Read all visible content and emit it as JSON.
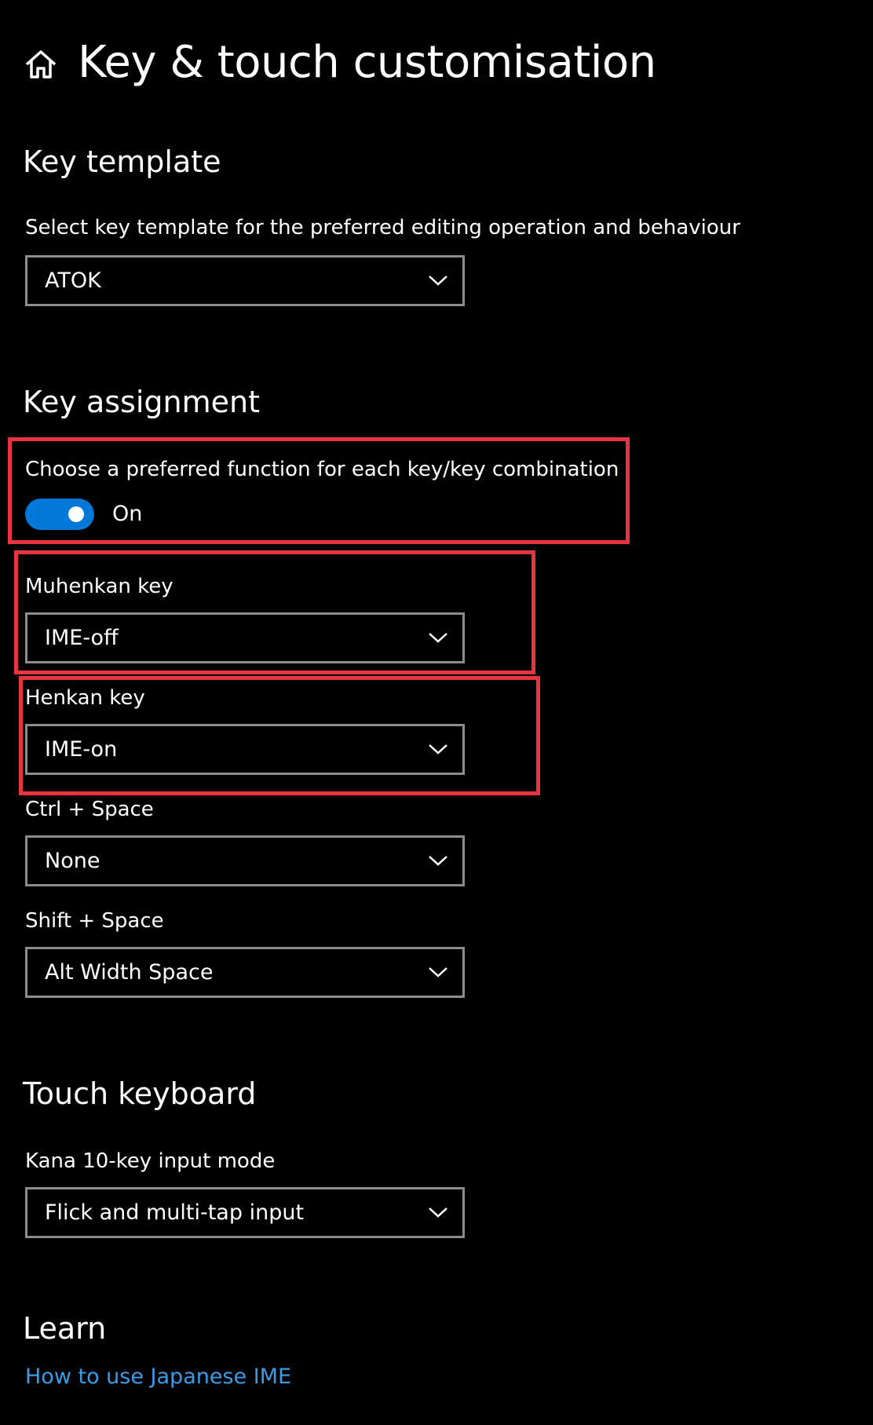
{
  "page": {
    "title": "Key & touch customisation",
    "home_icon": "home-icon"
  },
  "key_template": {
    "heading": "Key template",
    "description": "Select key template for the preferred editing operation and behaviour",
    "value": "ATOK"
  },
  "key_assignment": {
    "heading": "Key assignment",
    "toggle_label": "Choose a preferred function for each key/key combination",
    "toggle_state": "On",
    "toggle_on": true,
    "muhenkan": {
      "label": "Muhenkan key",
      "value": "IME-off"
    },
    "henkan": {
      "label": "Henkan key",
      "value": "IME-on"
    },
    "ctrl_space": {
      "label": "Ctrl + Space",
      "value": "None"
    },
    "shift_space": {
      "label": "Shift + Space",
      "value": "Alt Width Space"
    }
  },
  "touch_keyboard": {
    "heading": "Touch keyboard",
    "kana_label": "Kana 10-key input mode",
    "kana_value": "Flick and multi-tap input"
  },
  "learn": {
    "heading": "Learn",
    "link": "How to use Japanese IME"
  },
  "colors": {
    "background": "#000000",
    "text": "#ffffff",
    "accent": "#0078d7",
    "link": "#3a9ce8",
    "highlight": "#e8343f",
    "dropdown_border": "#8c8c8c"
  }
}
